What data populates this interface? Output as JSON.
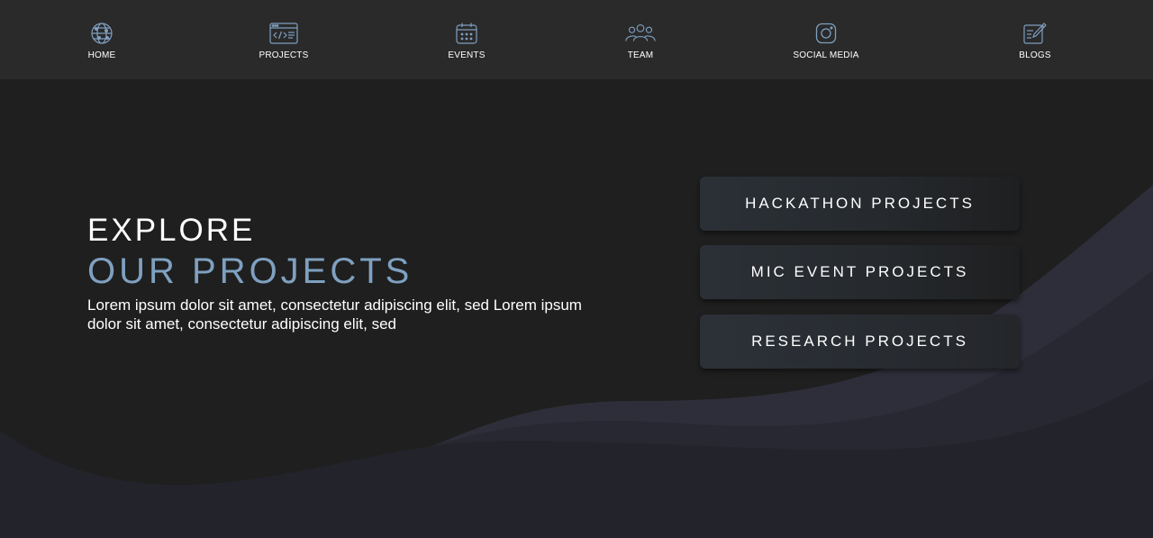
{
  "nav": {
    "items": [
      {
        "label": "HOME",
        "icon": "globe-network-icon"
      },
      {
        "label": "PROJECTS",
        "icon": "code-window-icon"
      },
      {
        "label": "EVENTS",
        "icon": "calendar-icon"
      },
      {
        "label": "TEAM",
        "icon": "people-group-icon"
      },
      {
        "label": "SOCIAL MEDIA",
        "icon": "instagram-icon"
      },
      {
        "label": "BLOGS",
        "icon": "pen-paper-icon"
      }
    ]
  },
  "hero": {
    "kicker": "EXPLORE",
    "title": "OUR PROJECTS",
    "description": "Lorem ipsum dolor sit amet, consectetur adipiscing elit, sed Lorem ipsum dolor sit amet, consectetur adipiscing elit, sed"
  },
  "buttons": {
    "hackathon": "HACKATHON PROJECTS",
    "mic": "MIC EVENT PROJECTS",
    "research": "RESEARCH PROJECTS"
  },
  "colors": {
    "background": "#1f1f1f",
    "navbar": "#2a2a2a",
    "accent": "#7fa0c0",
    "icon": "#7f9fc0",
    "wave_dark": "#23232c",
    "wave_mid": "#282833",
    "wave_light": "#2e2e3a"
  }
}
